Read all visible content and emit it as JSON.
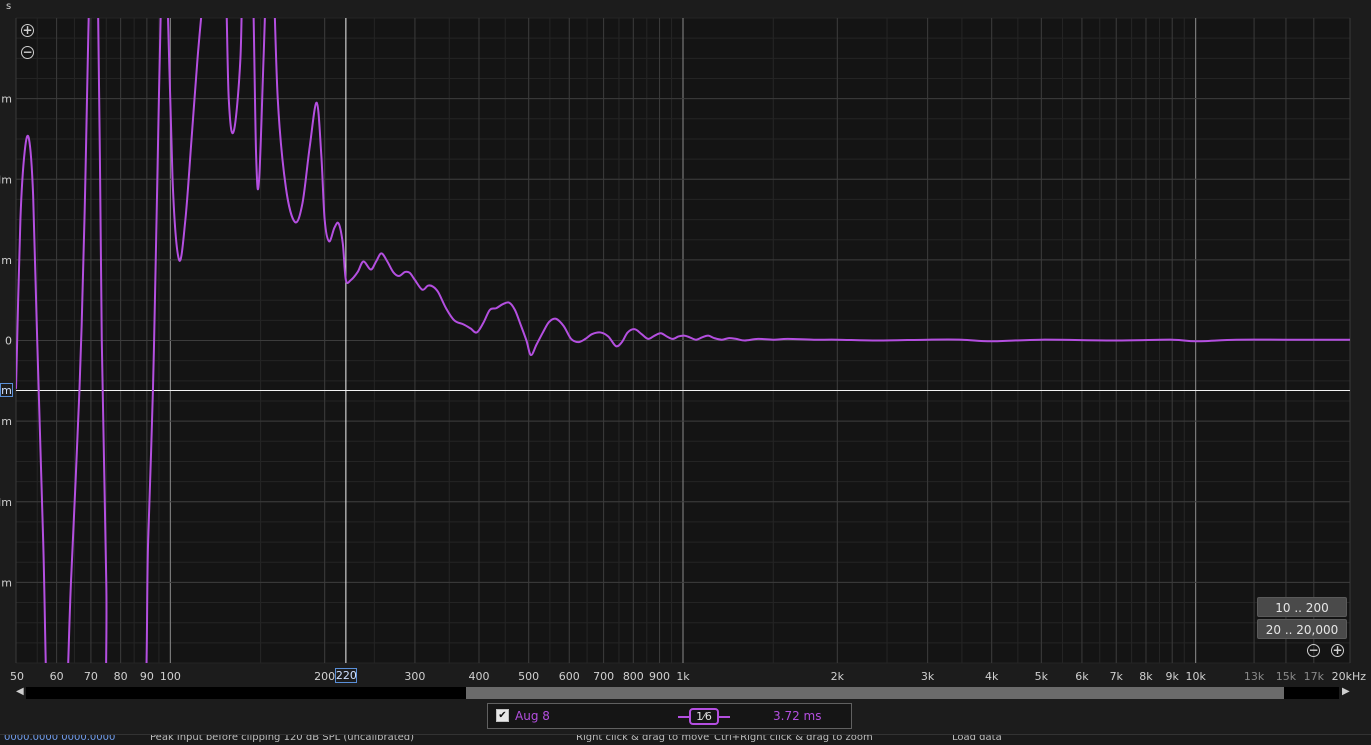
{
  "top_corner_label": "s",
  "chart_data": {
    "type": "line",
    "title": "",
    "xlabel": "",
    "ylabel": "",
    "x_scale": "log",
    "xlim": [
      50,
      20000
    ],
    "ylim": [
      -4,
      4
    ],
    "grid": true,
    "y_ticks": [
      {
        "value": 3,
        "label": "m"
      },
      {
        "value": 2,
        "label": "Im"
      },
      {
        "value": 1,
        "label": "m"
      },
      {
        "value": 0,
        "label": "0"
      },
      {
        "value": -1,
        "label": "m"
      },
      {
        "value": -2,
        "label": "Im"
      },
      {
        "value": -3,
        "label": "m"
      }
    ],
    "x_ticks": [
      {
        "value": 50,
        "label": "50"
      },
      {
        "value": 60,
        "label": "60"
      },
      {
        "value": 70,
        "label": "70"
      },
      {
        "value": 80,
        "label": "80"
      },
      {
        "value": 90,
        "label": "90"
      },
      {
        "value": 100,
        "label": "100"
      },
      {
        "value": 200,
        "label": "200"
      },
      {
        "value": 300,
        "label": "300"
      },
      {
        "value": 400,
        "label": "400"
      },
      {
        "value": 500,
        "label": "500"
      },
      {
        "value": 600,
        "label": "600"
      },
      {
        "value": 700,
        "label": "700"
      },
      {
        "value": 800,
        "label": "800"
      },
      {
        "value": 900,
        "label": "900"
      },
      {
        "value": 1000,
        "label": "1k"
      },
      {
        "value": 2000,
        "label": "2k"
      },
      {
        "value": 3000,
        "label": "3k"
      },
      {
        "value": 4000,
        "label": "4k"
      },
      {
        "value": 5000,
        "label": "5k"
      },
      {
        "value": 6000,
        "label": "6k"
      },
      {
        "value": 7000,
        "label": "7k"
      },
      {
        "value": 8000,
        "label": "8k"
      },
      {
        "value": 9000,
        "label": "9k"
      },
      {
        "value": 10000,
        "label": "10k"
      },
      {
        "value": 13000,
        "label": "13k",
        "dim": true
      },
      {
        "value": 15000,
        "label": "15k",
        "dim": true
      },
      {
        "value": 17000,
        "label": "17k",
        "dim": true
      },
      {
        "value": 20000,
        "label": "20kHz"
      }
    ],
    "cursor": {
      "x": 220,
      "x_label": "220",
      "y": -0.62,
      "y_label": "m"
    },
    "series": [
      {
        "name": "Aug 8",
        "color": "#b44fe0",
        "points": [
          [
            50,
            -0.6
          ],
          [
            51,
            1.5
          ],
          [
            52,
            2.35
          ],
          [
            53,
            2.5
          ],
          [
            54,
            1.8
          ],
          [
            55,
            0
          ],
          [
            56.5,
            -2.5
          ],
          [
            58,
            -5
          ],
          [
            62,
            -5
          ],
          [
            64,
            -3
          ],
          [
            66.5,
            -0.6
          ],
          [
            68,
            1.5
          ],
          [
            70,
            5
          ],
          [
            72,
            5
          ],
          [
            73.5,
            0
          ],
          [
            75,
            -3
          ],
          [
            76,
            -5
          ],
          [
            88,
            -5
          ],
          [
            90.5,
            -2.5
          ],
          [
            92.5,
            -0.6
          ],
          [
            94,
            1.5
          ],
          [
            96.5,
            5
          ],
          [
            98,
            5
          ],
          [
            101,
            2
          ],
          [
            104,
            1
          ],
          [
            107,
            1.5
          ],
          [
            110,
            2.5
          ],
          [
            113,
            3.5
          ],
          [
            116,
            4.3
          ],
          [
            119,
            5
          ],
          [
            127,
            5
          ],
          [
            130,
            3
          ],
          [
            133,
            2.6
          ],
          [
            137,
            3.5
          ],
          [
            139,
            5
          ],
          [
            144,
            5
          ],
          [
            147,
            2.3
          ],
          [
            149,
            2.0
          ],
          [
            152,
            3.5
          ],
          [
            155,
            5
          ],
          [
            158,
            5
          ],
          [
            162,
            3
          ],
          [
            168,
            1.9
          ],
          [
            175,
            1.47
          ],
          [
            181,
            1.7
          ],
          [
            187,
            2.4
          ],
          [
            193,
            2.95
          ],
          [
            197,
            2.3
          ],
          [
            200,
            1.5
          ],
          [
            204,
            1.23
          ],
          [
            209,
            1.4
          ],
          [
            213,
            1.45
          ],
          [
            217,
            1.2
          ],
          [
            220,
            0.75
          ],
          [
            225,
            0.75
          ],
          [
            232,
            0.85
          ],
          [
            238,
            0.98
          ],
          [
            246,
            0.88
          ],
          [
            252,
            0.98
          ],
          [
            258,
            1.08
          ],
          [
            265,
            0.98
          ],
          [
            272,
            0.85
          ],
          [
            279,
            0.8
          ],
          [
            287,
            0.85
          ],
          [
            293,
            0.84
          ],
          [
            300,
            0.75
          ],
          [
            310,
            0.63
          ],
          [
            318,
            0.68
          ],
          [
            325,
            0.67
          ],
          [
            333,
            0.6
          ],
          [
            345,
            0.4
          ],
          [
            358,
            0.25
          ],
          [
            373,
            0.2
          ],
          [
            385,
            0.15
          ],
          [
            396,
            0.1
          ],
          [
            408,
            0.22
          ],
          [
            420,
            0.38
          ],
          [
            432,
            0.4
          ],
          [
            445,
            0.45
          ],
          [
            458,
            0.47
          ],
          [
            470,
            0.38
          ],
          [
            482,
            0.2
          ],
          [
            495,
            0
          ],
          [
            505,
            -0.18
          ],
          [
            518,
            -0.05
          ],
          [
            533,
            0.1
          ],
          [
            548,
            0.23
          ],
          [
            565,
            0.27
          ],
          [
            585,
            0.18
          ],
          [
            605,
            0.02
          ],
          [
            625,
            -0.02
          ],
          [
            645,
            0.02
          ],
          [
            665,
            0.08
          ],
          [
            690,
            0.1
          ],
          [
            715,
            0.05
          ],
          [
            740,
            -0.07
          ],
          [
            760,
            -0.02
          ],
          [
            780,
            0.1
          ],
          [
            805,
            0.14
          ],
          [
            830,
            0.08
          ],
          [
            855,
            0.02
          ],
          [
            880,
            0.06
          ],
          [
            905,
            0.09
          ],
          [
            930,
            0.05
          ],
          [
            955,
            0.02
          ],
          [
            980,
            0.05
          ],
          [
            1005,
            0.06
          ],
          [
            1030,
            0.04
          ],
          [
            1060,
            0.01
          ],
          [
            1090,
            0.04
          ],
          [
            1120,
            0.06
          ],
          [
            1150,
            0.03
          ],
          [
            1190,
            0.01
          ],
          [
            1230,
            0.03
          ],
          [
            1270,
            0.02
          ],
          [
            1320,
            0
          ],
          [
            1400,
            0.02
          ],
          [
            1500,
            0.01
          ],
          [
            1600,
            0.02
          ],
          [
            1800,
            0.01
          ],
          [
            2000,
            0.01
          ],
          [
            2400,
            0
          ],
          [
            3000,
            0.01
          ],
          [
            3500,
            0.01
          ],
          [
            4000,
            -0.01
          ],
          [
            5000,
            0.01
          ],
          [
            7000,
            0
          ],
          [
            9000,
            0.01
          ],
          [
            10000,
            -0.01
          ],
          [
            12000,
            0.01
          ],
          [
            15000,
            0.01
          ],
          [
            20000,
            0.01
          ]
        ]
      }
    ]
  },
  "range_buttons": [
    "10 .. 200",
    "20 .. 20,000"
  ],
  "legend": {
    "checked": "✔",
    "name": "Aug 8",
    "smoothing": "1⁄6",
    "time": "3.72 ms"
  },
  "status": {
    "left_value": "0000.0000 0000.0000",
    "message": "Peak input before clipping 120 dB SPL (uncalibrated)",
    "hint1": "Right click & drag to move",
    "hint2": "Ctrl+Right click & drag to zoom",
    "hint3": "Load data"
  }
}
